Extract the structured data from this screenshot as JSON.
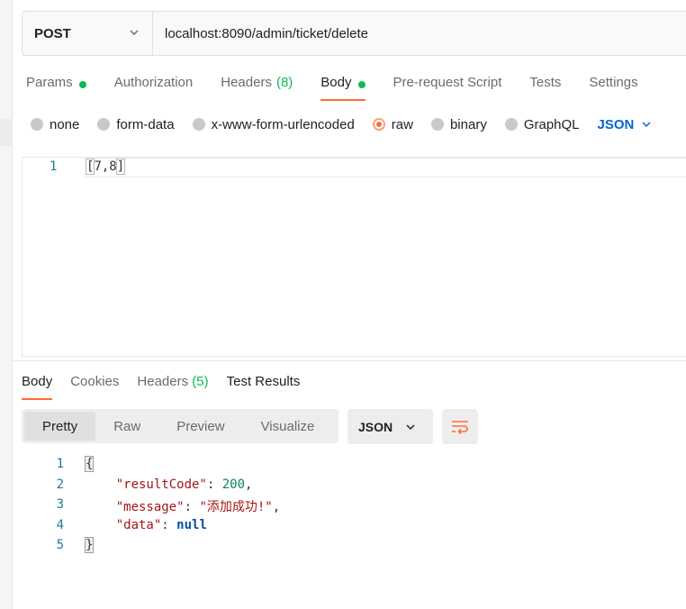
{
  "request": {
    "method": "POST",
    "url": "localhost:8090/admin/ticket/delete"
  },
  "request_tabs": [
    {
      "label": "Params",
      "dot": true
    },
    {
      "label": "Authorization"
    },
    {
      "label": "Headers",
      "count": "(8)"
    },
    {
      "label": "Body",
      "dot": true,
      "active": true
    },
    {
      "label": "Pre-request Script"
    },
    {
      "label": "Tests"
    },
    {
      "label": "Settings"
    }
  ],
  "body_types": [
    {
      "label": "none"
    },
    {
      "label": "form-data"
    },
    {
      "label": "x-www-form-urlencoded"
    },
    {
      "label": "raw",
      "selected": true
    },
    {
      "label": "binary"
    },
    {
      "label": "GraphQL"
    }
  ],
  "body_format": "JSON",
  "editor": {
    "line_number": "1",
    "content_open": "[",
    "content_mid": "7,8",
    "content_close": "]"
  },
  "response_tabs": [
    {
      "label": "Body",
      "active": true
    },
    {
      "label": "Cookies"
    },
    {
      "label": "Headers",
      "count": "(5)"
    },
    {
      "label": "Test Results"
    }
  ],
  "view_modes": [
    "Pretty",
    "Raw",
    "Preview",
    "Visualize"
  ],
  "response_format": "JSON",
  "response_lines": {
    "n1": "1",
    "n2": "2",
    "n3": "3",
    "n4": "4",
    "n5": "5",
    "open": "{",
    "k1": "\"resultCode\"",
    "v1": "200",
    "k2": "\"message\"",
    "v2": "\"添加成功!\"",
    "k3": "\"data\"",
    "v3": "null",
    "close": "}"
  },
  "colors": {
    "accent": "#ff6c37",
    "status_green": "#0cbb52",
    "link_blue": "#0265d2"
  },
  "icons": {
    "method_dropdown": "chevron-down-icon",
    "format_dropdown": "chevron-down-icon",
    "wrap": "wrap-lines-icon"
  }
}
